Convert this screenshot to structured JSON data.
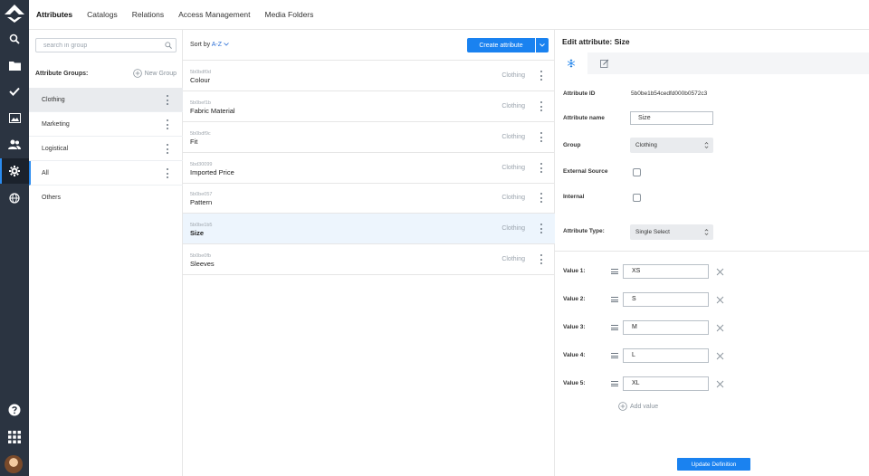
{
  "nav": {
    "tabs": [
      {
        "label": "Attributes",
        "active": true
      },
      {
        "label": "Catalogs",
        "active": false
      },
      {
        "label": "Relations",
        "active": false
      },
      {
        "label": "Access Management",
        "active": false
      },
      {
        "label": "Media Folders",
        "active": false
      }
    ]
  },
  "rail": {
    "icons": [
      "logo-icon",
      "search-icon",
      "folder-icon",
      "check-icon",
      "image-icon",
      "users-icon",
      "gear-icon",
      "globe-icon",
      "help-icon",
      "apps-grid-icon",
      "avatar"
    ],
    "active": "gear-icon"
  },
  "groups": {
    "search_placeholder": "search in group",
    "heading": "Attribute Groups:",
    "new_group_label": "New Group",
    "items": [
      {
        "label": "Clothing",
        "selected": true,
        "menu": true
      },
      {
        "label": "Marketing",
        "selected": false,
        "menu": true
      },
      {
        "label": "Logistical",
        "selected": false,
        "menu": true
      },
      {
        "label": "All",
        "selected": false,
        "menu": true,
        "active": true
      },
      {
        "label": "Others",
        "selected": false,
        "menu": false
      }
    ]
  },
  "attributes": {
    "sort_label": "Sort by",
    "sort_value": "A-Z",
    "create_label": "Create attribute",
    "rows": [
      {
        "id": "5b0bdf0d",
        "name": "Colour",
        "group": "Clothing",
        "selected": false
      },
      {
        "id": "5b0bef1b",
        "name": "Fabric Material",
        "group": "Clothing",
        "selected": false
      },
      {
        "id": "5b0bdf9c",
        "name": "Fit",
        "group": "Clothing",
        "selected": false
      },
      {
        "id": "5bd30099",
        "name": "Imported Price",
        "group": "Clothing",
        "selected": false
      },
      {
        "id": "5b0be057",
        "name": "Pattern",
        "group": "Clothing",
        "selected": false
      },
      {
        "id": "5b0be1b5",
        "name": "Size",
        "group": "Clothing",
        "selected": true
      },
      {
        "id": "5b0be0fb",
        "name": "Sleeves",
        "group": "Clothing",
        "selected": false
      }
    ]
  },
  "edit": {
    "title": "Edit attribute: Size",
    "fields": {
      "attribute_id_label": "Attribute ID",
      "attribute_id_value": "5b0be1b54cedfd000b0572c3",
      "name_label": "Attribute name",
      "name_value": "Size",
      "group_label": "Group",
      "group_value": "Clothing",
      "external_label": "External Source",
      "external_checked": false,
      "internal_label": "Internal",
      "internal_checked": false,
      "type_label": "Attribute Type:",
      "type_value": "Single Select"
    },
    "values": [
      {
        "label": "Value 1:",
        "value": "XS"
      },
      {
        "label": "Value 2:",
        "value": "S"
      },
      {
        "label": "Value 3:",
        "value": "M"
      },
      {
        "label": "Value 4:",
        "value": "L"
      },
      {
        "label": "Value 5:",
        "value": "XL"
      }
    ],
    "add_value_label": "Add value",
    "update_label": "Update Definition"
  },
  "colors": {
    "accent": "#1a82f0",
    "rail": "#2b3441",
    "selected_row": "#edf5fd"
  }
}
